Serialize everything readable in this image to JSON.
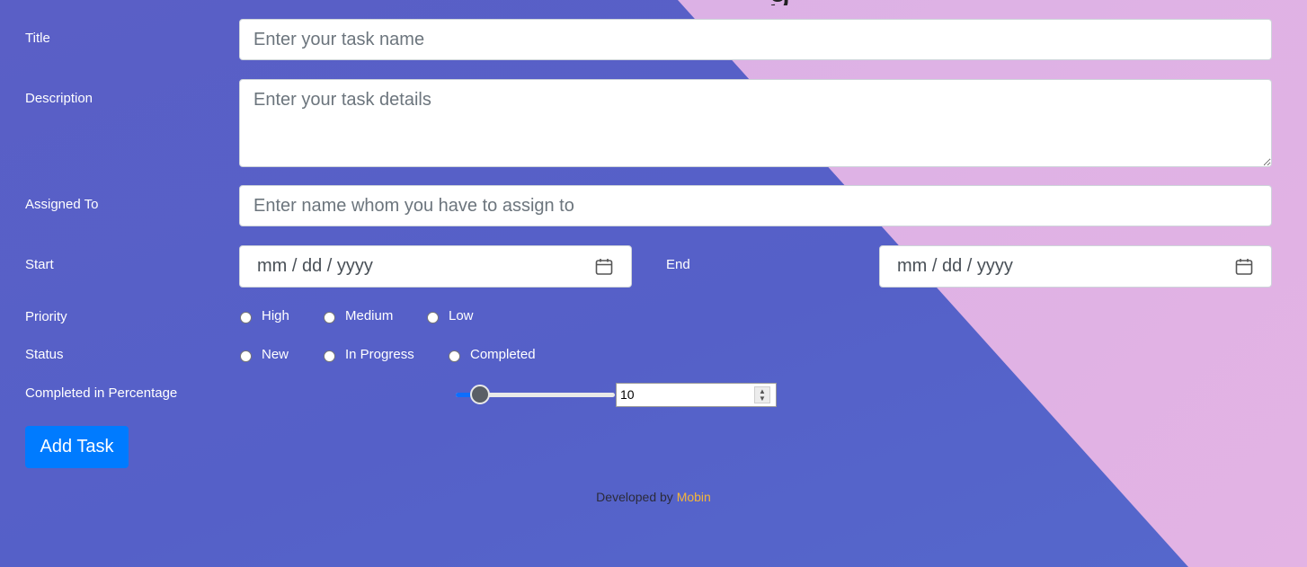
{
  "heading_fragment": "g",
  "form": {
    "title": {
      "label": "Title",
      "placeholder": "Enter your task name"
    },
    "description": {
      "label": "Description",
      "placeholder": "Enter your task details"
    },
    "assigned_to": {
      "label": "Assigned To",
      "placeholder": "Enter name whom you have to assign to"
    },
    "start": {
      "label": "Start",
      "value": "mm / dd / yyyy",
      "icon": "calendar-icon"
    },
    "end": {
      "label": "End",
      "value": "mm / dd / yyyy",
      "icon": "calendar-icon"
    },
    "priority": {
      "label": "Priority",
      "options": [
        "High",
        "Medium",
        "Low"
      ]
    },
    "status": {
      "label": "Status",
      "options": [
        "New",
        "In Progress",
        "Completed"
      ]
    },
    "completed_percentage": {
      "label": "Completed in Percentage",
      "value": "10",
      "slider_fraction": 0.1
    },
    "submit_label": "Add Task"
  },
  "footer": {
    "prefix": "Developed by",
    "author": "Mobin"
  },
  "colors": {
    "primary": "#007bff",
    "author": "#f4b53a",
    "background": "#5a5fc6",
    "accent_pink": "#dcb2e5"
  }
}
